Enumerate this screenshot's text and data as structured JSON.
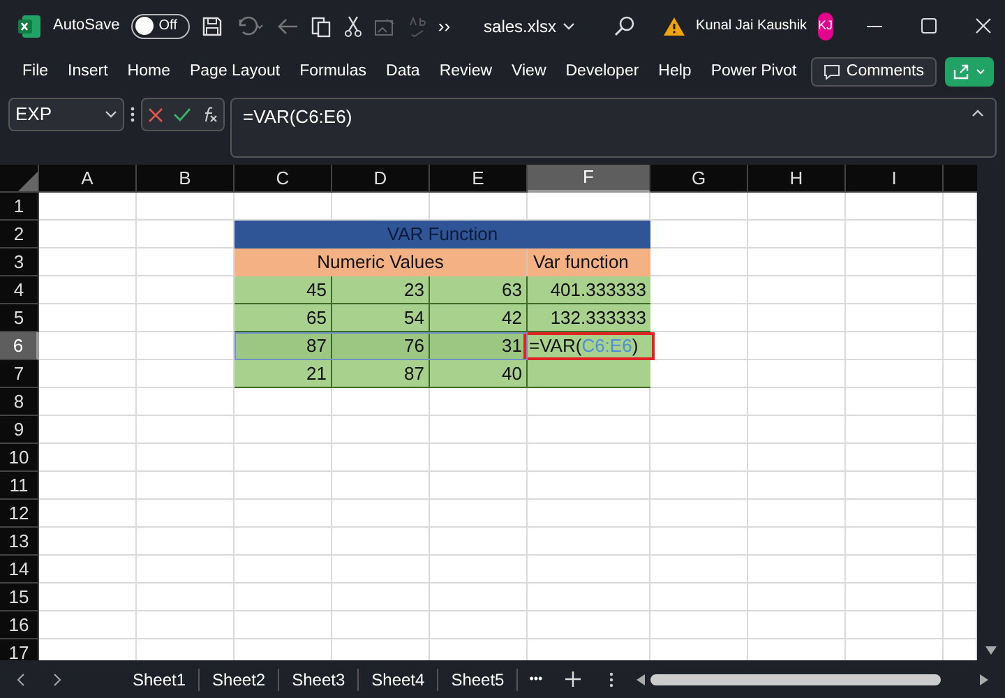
{
  "title_bar": {
    "autosave_label": "AutoSave",
    "autosave": {
      "on": false,
      "label": "Off"
    },
    "more": "››",
    "file_name": "sales.xlsx",
    "user_name": "Kunal Jai Kaushik",
    "avatar_initials": "KJ"
  },
  "menu": [
    {
      "label": "File"
    },
    {
      "label": "Insert"
    },
    {
      "label": "Home"
    },
    {
      "label": "Page Layout"
    },
    {
      "label": "Formulas"
    },
    {
      "label": "Data"
    },
    {
      "label": "Review"
    },
    {
      "label": "View"
    },
    {
      "label": "Developer"
    },
    {
      "label": "Help"
    },
    {
      "label": "Power Pivot"
    }
  ],
  "comments_button": "Comments",
  "name_box": "EXP",
  "formula": "=VAR(C6:E6)",
  "columns": [
    {
      "label": "A",
      "selected": false
    },
    {
      "label": "B",
      "selected": false
    },
    {
      "label": "C",
      "selected": false
    },
    {
      "label": "D",
      "selected": false
    },
    {
      "label": "E",
      "selected": false
    },
    {
      "label": "F",
      "selected": true
    },
    {
      "label": "G",
      "selected": false
    },
    {
      "label": "H",
      "selected": false
    },
    {
      "label": "I",
      "selected": false
    }
  ],
  "rows": [
    {
      "label": "1",
      "selected": false
    },
    {
      "label": "2",
      "selected": false
    },
    {
      "label": "3",
      "selected": false
    },
    {
      "label": "4",
      "selected": false
    },
    {
      "label": "5",
      "selected": false
    },
    {
      "label": "6",
      "selected": true
    },
    {
      "label": "7",
      "selected": false
    },
    {
      "label": "8",
      "selected": false
    },
    {
      "label": "9",
      "selected": false
    },
    {
      "label": "10",
      "selected": false
    },
    {
      "label": "11",
      "selected": false
    },
    {
      "label": "12",
      "selected": false
    },
    {
      "label": "13",
      "selected": false
    },
    {
      "label": "14",
      "selected": false
    },
    {
      "label": "15",
      "selected": false
    },
    {
      "label": "16",
      "selected": false
    },
    {
      "label": "17",
      "selected": false
    }
  ],
  "table": {
    "title": "VAR Function",
    "header": [
      "Numeric Values",
      "Var function"
    ],
    "rows": [
      {
        "values": [
          "45",
          "23",
          "63"
        ],
        "result": "401.333333",
        "selected": false
      },
      {
        "values": [
          "65",
          "54",
          "42"
        ],
        "result": "132.333333",
        "selected": false
      },
      {
        "values": [
          "87",
          "76",
          "31"
        ],
        "selected": true,
        "editor": {
          "prefix": "=VAR(",
          "reference": "C6:E6",
          "suffix": ")"
        }
      },
      {
        "values": [
          "21",
          "87",
          "40"
        ],
        "selected": false
      }
    ]
  },
  "sheets": [
    {
      "label": "Sheet1"
    },
    {
      "label": "Sheet2"
    },
    {
      "label": "Sheet3"
    },
    {
      "label": "Sheet4"
    },
    {
      "label": "Sheet5"
    }
  ],
  "sheet_more": "•••"
}
